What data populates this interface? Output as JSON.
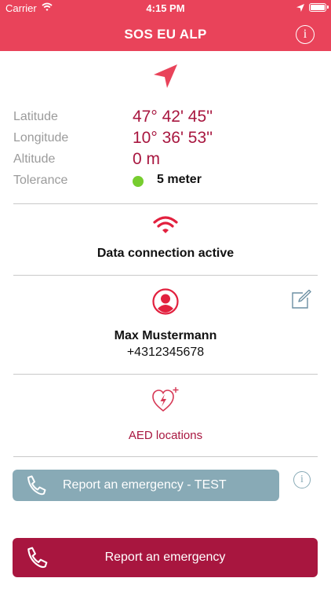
{
  "status_bar": {
    "carrier": "Carrier",
    "time": "4:15 PM"
  },
  "header": {
    "title": "SOS EU ALP",
    "info_symbol": "i",
    "background_color": "#e9435a"
  },
  "location": {
    "rows": [
      {
        "label": "Latitude",
        "value": "47° 42' 45''"
      },
      {
        "label": "Longitude",
        "value": "10° 36' 53''"
      },
      {
        "label": "Altitude",
        "value": "0 m"
      }
    ],
    "tolerance": {
      "label": "Tolerance",
      "value": "5 meter",
      "indicator_color": "#77cd2f"
    },
    "accent_color": "#a8163f"
  },
  "connection": {
    "status_text": "Data connection active",
    "icon": "wifi-icon"
  },
  "contact": {
    "name": "Max Mustermann",
    "phone": "+4312345678",
    "icon": "person-icon",
    "edit_icon": "edit-icon"
  },
  "aed": {
    "label": "AED locations",
    "icon": "heart-defibrillator-icon"
  },
  "buttons": {
    "test_report": {
      "label": "Report an emergency - TEST",
      "color": "#88aab6",
      "info_symbol": "i"
    },
    "report": {
      "label": "Report an emergency",
      "color": "#a8163f"
    }
  }
}
